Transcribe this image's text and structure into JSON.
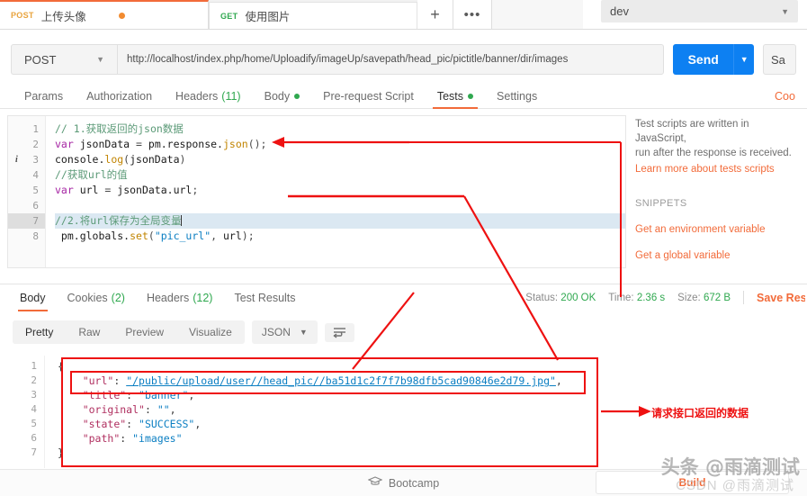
{
  "window": {
    "request_tabs": [
      {
        "method": "POST",
        "label": "上传头像",
        "unsaved": true,
        "active": true
      },
      {
        "method": "GET",
        "label": "使用图片",
        "unsaved": false,
        "active": false
      }
    ],
    "new_tab_icon": "+",
    "more_icon": "•••",
    "environment": "dev",
    "environment_caret": "▼"
  },
  "url_bar": {
    "method": "POST",
    "method_caret": "▼",
    "url": "http://localhost/index.php/home/Uploadify/imageUp/savepath/head_pic/pictitle/banner/dir/images",
    "send_label": "Send",
    "send_caret": "▼",
    "save_label": "Sa",
    "send_color": "#0d80f2"
  },
  "request_tabs": {
    "items": [
      {
        "label": "Params",
        "count": "",
        "dot": false,
        "active": false
      },
      {
        "label": "Authorization",
        "count": "",
        "dot": false,
        "active": false
      },
      {
        "label": "Headers",
        "count": "(11)",
        "dot": false,
        "active": false
      },
      {
        "label": "Body",
        "count": "",
        "dot": true,
        "active": false
      },
      {
        "label": "Pre-request Script",
        "count": "",
        "dot": false,
        "active": false
      },
      {
        "label": "Tests",
        "count": "",
        "dot": true,
        "active": true
      },
      {
        "label": "Settings",
        "count": "",
        "dot": false,
        "active": false
      }
    ],
    "cookies_link": "Coo"
  },
  "editor": {
    "lines": [
      {
        "n": "1",
        "info": false,
        "highlight": false,
        "tokens": [
          {
            "t": "comment",
            "v": "// 1.获取返回的json数据"
          }
        ]
      },
      {
        "n": "2",
        "info": false,
        "highlight": false,
        "tokens": [
          {
            "t": "kw",
            "v": "var"
          },
          {
            "t": "plain",
            "v": " jsonData "
          },
          {
            "t": "pun",
            "v": "="
          },
          {
            "t": "plain",
            "v": " pm."
          },
          {
            "t": "plain",
            "v": "response."
          },
          {
            "t": "fn",
            "v": "json"
          },
          {
            "t": "pun",
            "v": "();"
          }
        ]
      },
      {
        "n": "3",
        "info": true,
        "highlight": false,
        "tokens": [
          {
            "t": "plain",
            "v": "console."
          },
          {
            "t": "fn",
            "v": "log"
          },
          {
            "t": "pun",
            "v": "("
          },
          {
            "t": "plain",
            "v": "jsonData"
          },
          {
            "t": "pun",
            "v": ")"
          }
        ]
      },
      {
        "n": "4",
        "info": false,
        "highlight": false,
        "tokens": [
          {
            "t": "comment",
            "v": "//获取url的值"
          }
        ]
      },
      {
        "n": "5",
        "info": false,
        "highlight": false,
        "tokens": [
          {
            "t": "kw",
            "v": "var"
          },
          {
            "t": "plain",
            "v": " url "
          },
          {
            "t": "pun",
            "v": "="
          },
          {
            "t": "plain",
            "v": " jsonData.url"
          },
          {
            "t": "pun",
            "v": ";"
          }
        ]
      },
      {
        "n": "6",
        "info": false,
        "highlight": false,
        "tokens": [
          {
            "t": "plain",
            "v": ""
          }
        ]
      },
      {
        "n": "7",
        "info": false,
        "highlight": true,
        "tokens": [
          {
            "t": "comment",
            "v": "//2.将url保存为全局变量"
          }
        ]
      },
      {
        "n": "8",
        "info": false,
        "highlight": false,
        "tokens": [
          {
            "t": "plain",
            "v": " pm.globals."
          },
          {
            "t": "fn",
            "v": "set"
          },
          {
            "t": "pun",
            "v": "("
          },
          {
            "t": "str",
            "v": "\"pic_url\""
          },
          {
            "t": "pun",
            "v": ", "
          },
          {
            "t": "plain",
            "v": "url"
          },
          {
            "t": "pun",
            "v": ");"
          }
        ]
      }
    ]
  },
  "snippets": {
    "description_line1": "Test scripts are written in JavaScript,",
    "description_line2": "run after the response is received.",
    "learn_more": "Learn more about tests scripts",
    "heading": "SNIPPETS",
    "items": [
      "Get an environment variable",
      "Get a global variable"
    ]
  },
  "response_tabs": {
    "items": [
      {
        "label": "Body",
        "count": "",
        "active": true
      },
      {
        "label": "Cookies",
        "count": "(2)",
        "active": false
      },
      {
        "label": "Headers",
        "count": "(12)",
        "active": false
      },
      {
        "label": "Test Results",
        "count": "",
        "active": false
      }
    ],
    "status_label": "Status:",
    "status_value": "200 OK",
    "time_label": "Time:",
    "time_value": "2.36 s",
    "size_label": "Size:",
    "size_value": "672 B",
    "save_response": "Save Res"
  },
  "response_view": {
    "modes": [
      "Pretty",
      "Raw",
      "Preview",
      "Visualize"
    ],
    "active_mode": "Pretty",
    "format": "JSON",
    "format_caret": "▼",
    "wrap_icon": "wrap-lines-icon"
  },
  "response_body": {
    "lines": [
      {
        "n": "1",
        "parts": [
          {
            "t": "brace",
            "v": "{"
          }
        ]
      },
      {
        "n": "2",
        "parts": [
          {
            "t": "plain",
            "v": "    "
          },
          {
            "t": "key",
            "v": "\"url\""
          },
          {
            "t": "plain",
            "v": ": "
          },
          {
            "t": "link",
            "v": "\"/public/upload/user//head_pic//ba51d1c2f7f7b98dfb5cad90846e2d79.jpg\""
          },
          {
            "t": "plain",
            "v": ","
          }
        ]
      },
      {
        "n": "3",
        "parts": [
          {
            "t": "plain",
            "v": "    "
          },
          {
            "t": "key",
            "v": "\"title\""
          },
          {
            "t": "plain",
            "v": ": "
          },
          {
            "t": "val",
            "v": "\"banner\""
          },
          {
            "t": "plain",
            "v": ","
          }
        ]
      },
      {
        "n": "4",
        "parts": [
          {
            "t": "plain",
            "v": "    "
          },
          {
            "t": "key",
            "v": "\"original\""
          },
          {
            "t": "plain",
            "v": ": "
          },
          {
            "t": "val",
            "v": "\"\""
          },
          {
            "t": "plain",
            "v": ","
          }
        ]
      },
      {
        "n": "5",
        "parts": [
          {
            "t": "plain",
            "v": "    "
          },
          {
            "t": "key",
            "v": "\"state\""
          },
          {
            "t": "plain",
            "v": ": "
          },
          {
            "t": "val",
            "v": "\"SUCCESS\""
          },
          {
            "t": "plain",
            "v": ","
          }
        ]
      },
      {
        "n": "6",
        "parts": [
          {
            "t": "plain",
            "v": "    "
          },
          {
            "t": "key",
            "v": "\"path\""
          },
          {
            "t": "plain",
            "v": ": "
          },
          {
            "t": "val",
            "v": "\"images\""
          }
        ]
      },
      {
        "n": "7",
        "parts": [
          {
            "t": "brace",
            "v": "}"
          }
        ]
      }
    ]
  },
  "annotations": {
    "callout_text": "请求接口返回的数据",
    "color": "#ee1111"
  },
  "footer": {
    "bootcamp_label": "Bootcamp",
    "bootcamp_icon": "graduation-cap-icon",
    "build_label": "Build"
  },
  "watermark": {
    "primary": "头条 @雨滴测试",
    "secondary": "CSDN @雨滴测试"
  }
}
